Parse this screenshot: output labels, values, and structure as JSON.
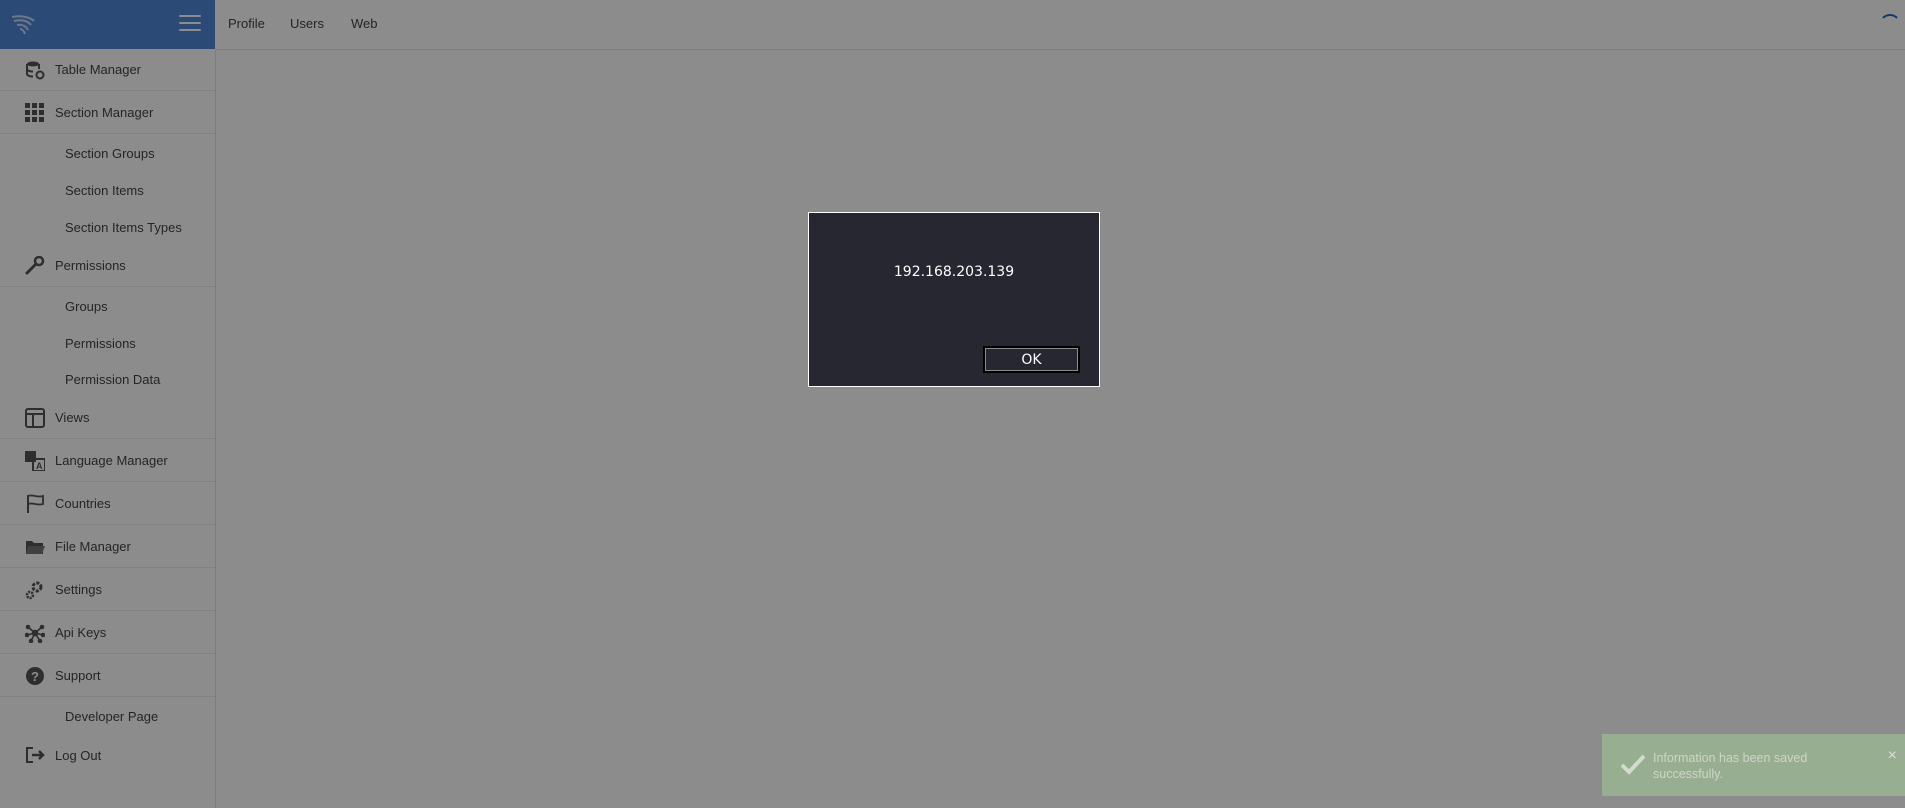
{
  "topbar": {
    "links": [
      "Profile",
      "Users",
      "Web"
    ]
  },
  "sidebar": {
    "items": [
      {
        "label": "Table Manager",
        "icon": "database-icon"
      },
      {
        "label": "Section Manager",
        "icon": "grid-icon"
      },
      {
        "label": "Section Groups"
      },
      {
        "label": "Section Items"
      },
      {
        "label": "Section Items Types"
      },
      {
        "label": "Permissions",
        "icon": "wrench-icon"
      },
      {
        "label": "Groups"
      },
      {
        "label": "Permissions"
      },
      {
        "label": "Permission Data"
      },
      {
        "label": "Views",
        "icon": "layout-icon"
      },
      {
        "label": "Language Manager",
        "icon": "translate-icon"
      },
      {
        "label": "Countries",
        "icon": "flag-icon"
      },
      {
        "label": "File Manager",
        "icon": "folder-icon"
      },
      {
        "label": "Settings",
        "icon": "gear-icon"
      },
      {
        "label": "Api Keys",
        "icon": "network-icon"
      },
      {
        "label": "Support",
        "icon": "question-icon"
      },
      {
        "label": "Developer Page"
      },
      {
        "label": "Log Out",
        "icon": "logout-icon"
      }
    ]
  },
  "dialog": {
    "message": "192.168.203.139",
    "ok_label": "OK"
  },
  "toast": {
    "message": "Information has been saved successfully.",
    "close": "×"
  },
  "colors": {
    "brand": "#4f87d7",
    "dialog_bg": "#262731",
    "toast_bg": "#9bb491",
    "overlay": "rgba(0,0,0,0.45)"
  }
}
